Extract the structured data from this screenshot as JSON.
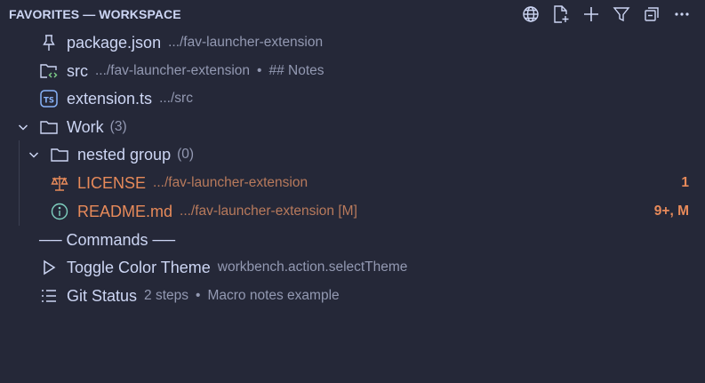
{
  "header": {
    "title": "FAVORITES — WORKSPACE",
    "actions": [
      {
        "icon": "globe-icon",
        "label": "Workspace scope"
      },
      {
        "icon": "new-file-icon",
        "label": "Add file"
      },
      {
        "icon": "plus-icon",
        "label": "Add"
      },
      {
        "icon": "filter-icon",
        "label": "Filter"
      },
      {
        "icon": "collapse-all-icon",
        "label": "Collapse all"
      },
      {
        "icon": "more-icon",
        "label": "More actions"
      }
    ]
  },
  "items": {
    "package_json": {
      "icon": "pin-icon",
      "label": "package.json",
      "description": ".../fav-launcher-extension"
    },
    "src": {
      "icon": "folder-code-icon",
      "label": "src",
      "description": ".../fav-launcher-extension",
      "note": "## Notes"
    },
    "extension_ts": {
      "icon": "typescript-icon",
      "label": "extension.ts",
      "description": ".../src"
    },
    "work": {
      "icon": "folder-icon",
      "label": "Work",
      "count": "(3)"
    },
    "nested_group": {
      "icon": "folder-icon",
      "label": "nested group",
      "count": "(0)"
    },
    "license": {
      "icon": "law-icon",
      "label": "LICENSE",
      "description": ".../fav-launcher-extension",
      "badge": "1"
    },
    "readme": {
      "icon": "info-icon",
      "label": "README.md",
      "description": ".../fav-launcher-extension [M]",
      "badge": "9+, M"
    }
  },
  "commands_separator": {
    "label": "── Commands ──"
  },
  "commands": {
    "toggle_theme": {
      "icon": "play-icon",
      "label": "Toggle Color Theme",
      "description": "workbench.action.selectTheme"
    },
    "git_status": {
      "icon": "list-icon",
      "label": "Git Status",
      "description": "2 steps",
      "note": "Macro notes example"
    }
  },
  "colors": {
    "background": "#252838",
    "text": "#cdd6f4",
    "muted": "#9399b2",
    "modified": "#e78a5a",
    "info": "#7fd0c0"
  }
}
